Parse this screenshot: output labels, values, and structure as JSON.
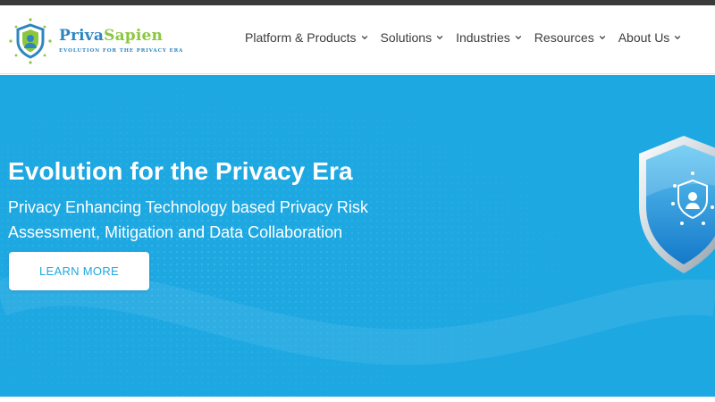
{
  "brand": {
    "name_part1": "Priva",
    "name_part2": "Sapien",
    "tagline": "EVOLUTION FOR THE PRIVACY ERA",
    "logo_icon": "shield-logo-icon",
    "colors": {
      "blue": "#2e86c1",
      "green": "#8cc63f"
    }
  },
  "nav": {
    "items": [
      {
        "label": "Platform & Products",
        "icon": "chevron-down-icon"
      },
      {
        "label": "Solutions",
        "icon": "chevron-down-icon"
      },
      {
        "label": "Industries",
        "icon": "chevron-down-icon"
      },
      {
        "label": "Resources",
        "icon": "chevron-down-icon"
      },
      {
        "label": "About Us",
        "icon": "chevron-down-icon"
      }
    ]
  },
  "hero": {
    "title": "Evolution for the Privacy Era",
    "subtitle": "Privacy Enhancing Technology based Privacy Risk Assessment, Mitigation and Data Collaboration",
    "cta_label": "LEARN MORE",
    "background_color": "#1ea8e2",
    "illustration": "shield-icon"
  }
}
